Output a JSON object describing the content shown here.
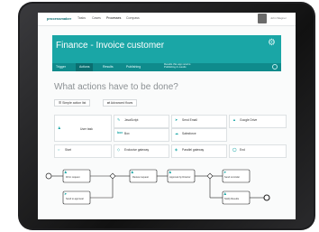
{
  "nav": {
    "logo": "processmaker",
    "links": [
      "Tasks",
      "Cases",
      "Processes",
      "Compass"
    ],
    "active_link": 2,
    "user": "John Wagner"
  },
  "banner": {
    "title": "Finance - Invoice customer",
    "tabs": [
      "Trigger",
      "Actions",
      "Results",
      "Publishing"
    ],
    "selected_tab": 1,
    "note_line1": "Results this app returns",
    "note_line2": "Publishing & results"
  },
  "main": {
    "question": "What actions have to be done?",
    "simple_mode": "Simple action list",
    "advanced_mode": "Advanced flows"
  },
  "palette": [
    {
      "label": "User task",
      "icon": "user-icon"
    },
    {
      "label": "JavaScript",
      "icon": "script-icon"
    },
    {
      "label": "Send Email",
      "icon": "send-icon"
    },
    {
      "label": "Google Drive",
      "icon": "drive-icon"
    },
    {
      "label": "Box",
      "icon": "box-icon"
    },
    {
      "label": "Salesforce",
      "icon": "cloud-icon"
    },
    {
      "label": "Start",
      "icon": "start-icon"
    },
    {
      "label": "Exclusive gateway",
      "icon": "gateway-icon"
    },
    {
      "label": "Parallel gateway",
      "icon": "parallel-icon"
    },
    {
      "label": "End",
      "icon": "end-icon"
    }
  ],
  "diagram": {
    "tasks": [
      "Fill in request",
      "Review request",
      "Send to approval",
      "Approval by Director",
      "Send reminder",
      "Notify Results"
    ]
  },
  "colors": {
    "accent": "#1aa6a6",
    "accent_dark": "#0f8b8c",
    "tablet": "#1e1e20"
  }
}
